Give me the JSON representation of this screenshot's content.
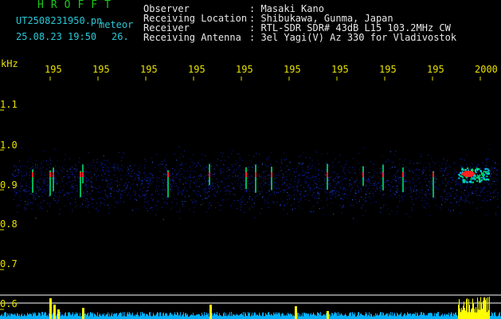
{
  "header": {
    "title": "HROFFT",
    "filename": "UT2508231950.pn",
    "meteor_label": "meteor",
    "datetime": "25.08.23 19:50",
    "count": "26.",
    "info_labels": [
      "Observer",
      "Receiving Location",
      "Receiver",
      "Receiving Antenna"
    ],
    "info_values": [
      ": Masaki Kano",
      ": Shibukawa, Gunma, Japan",
      ": RTL-SDR SDR# 43dB L15 103.2MHz CW",
      ": 3el Yagi(V) Az 330 for Vladivostok"
    ]
  },
  "spectrogram": {
    "y_unit": "kHz",
    "y_ticks": [
      "1.1",
      "1.0",
      "0.9",
      "0.8",
      "0.7",
      "0.6"
    ],
    "x_ticks": [
      "195",
      "195",
      "195",
      "195",
      "195",
      "195",
      "195",
      "195",
      "195",
      "2000"
    ],
    "colors": {
      "grid": "#ffffff",
      "ticks": "#e8e000",
      "noise": "#1428c8",
      "signal": "#00e070",
      "peak": "#ff2020",
      "trace": "#00b0ff",
      "meteor_bar": "#ffff00"
    }
  }
}
